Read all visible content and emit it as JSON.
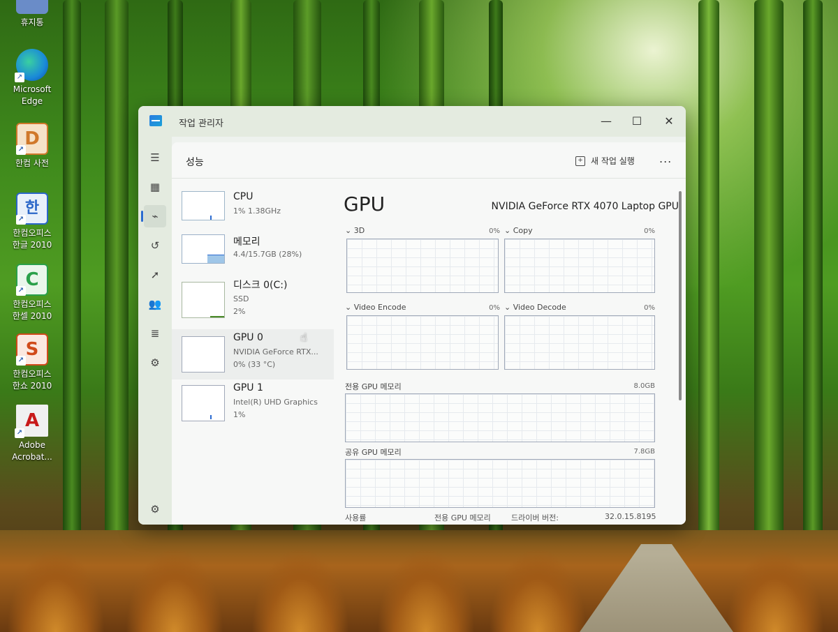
{
  "desktop": {
    "icons": [
      {
        "label": "휴지통",
        "color": "#6a8cc8",
        "glyph": "🗑"
      },
      {
        "label": "Microsoft Edge",
        "color": "#1a8ad8",
        "glyph": "e"
      },
      {
        "label": "한컴 사전",
        "color": "#d0782a",
        "glyph": "D"
      },
      {
        "label": "한컴오피스 한글 2010",
        "color": "#2a66c8",
        "glyph": "한"
      },
      {
        "label": "한컴오피스 한셀 2010",
        "color": "#2aa04a",
        "glyph": "C"
      },
      {
        "label": "한컴오피스 한쇼 2010",
        "color": "#d04a1a",
        "glyph": "S"
      },
      {
        "label": "Adobe Acrobat...",
        "color": "#e8e8e8",
        "glyph": "A"
      }
    ]
  },
  "window": {
    "title": "작업 관리자",
    "controls": {
      "minimize": "—",
      "maximize": "☐",
      "close": "✕"
    }
  },
  "nav": {
    "items": [
      {
        "name": "menu-icon",
        "glyph": "☰"
      },
      {
        "name": "processes-icon",
        "glyph": "▦"
      },
      {
        "name": "performance-icon",
        "glyph": "⌁"
      },
      {
        "name": "app-history-icon",
        "glyph": "↺"
      },
      {
        "name": "startup-icon",
        "glyph": "➚"
      },
      {
        "name": "users-icon",
        "glyph": "👥"
      },
      {
        "name": "details-icon",
        "glyph": "≣"
      },
      {
        "name": "services-icon",
        "glyph": "⚙"
      }
    ],
    "settings": "⚙"
  },
  "header": {
    "title": "성능",
    "run_new_task": "새 작업 실행",
    "more": "..."
  },
  "perf_list": [
    {
      "name": "CPU",
      "sub1": "1% 1.38GHz",
      "sub2": ""
    },
    {
      "name": "메모리",
      "sub1": "4.4/15.7GB (28%)",
      "sub2": ""
    },
    {
      "name": "디스크 0(C:)",
      "sub1": "SSD",
      "sub2": "2%"
    },
    {
      "name": "GPU 0",
      "sub1": "NVIDIA GeForce RTX...",
      "sub2": "0% (33 °C)"
    },
    {
      "name": "GPU 1",
      "sub1": "Intel(R) UHD Graphics",
      "sub2": "1%"
    }
  ],
  "gpu": {
    "title": "GPU",
    "model": "NVIDIA GeForce RTX 4070 Laptop GPU",
    "engines": [
      {
        "label": "3D",
        "percent": "0%"
      },
      {
        "label": "Copy",
        "percent": "0%"
      },
      {
        "label": "Video Encode",
        "percent": "0%"
      },
      {
        "label": "Video Decode",
        "percent": "0%"
      }
    ],
    "dedicated_memory": {
      "label": "전용 GPU 메모리",
      "value": "8.0GB"
    },
    "shared_memory": {
      "label": "공유 GPU 메모리",
      "value": "7.8GB"
    },
    "bottom": {
      "usage_label": "사용률",
      "dedicated_label": "전용 GPU 메모리",
      "driver_label": "드라이버 버전:",
      "driver_value": "32.0.15.8195"
    }
  }
}
